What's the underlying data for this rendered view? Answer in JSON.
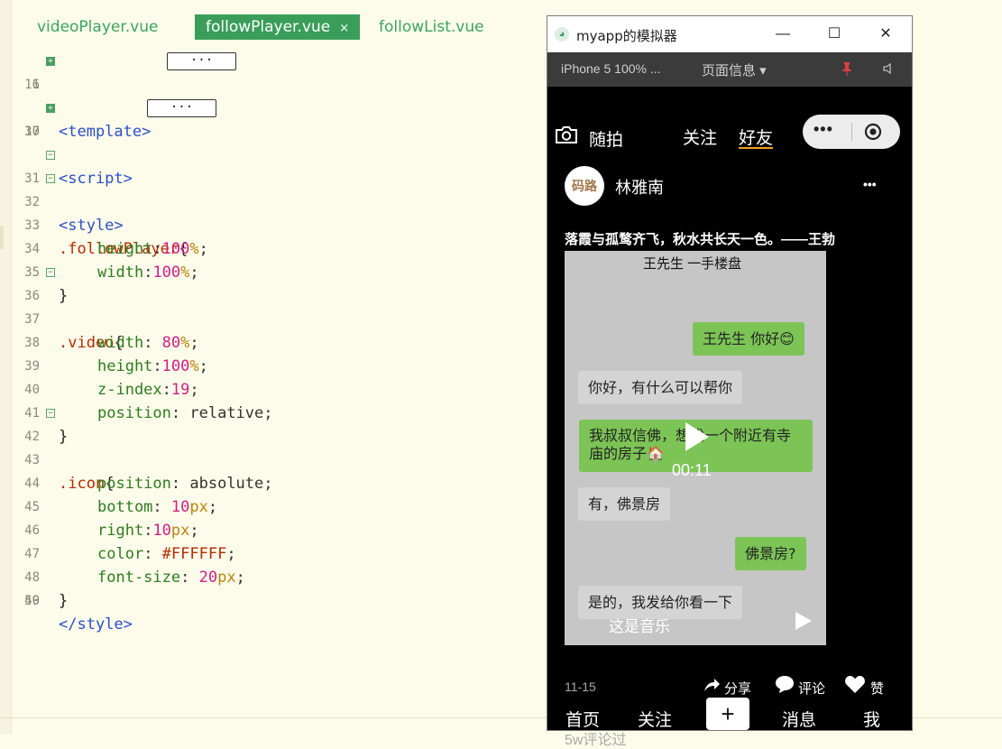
{
  "editor": {
    "tabs": [
      {
        "label": "videoPlayer.vue"
      },
      {
        "label": "followPlayer.vue",
        "close": "×"
      },
      {
        "label": "followList.vue"
      }
    ],
    "collapsed_label": "···",
    "lines": {
      "n1": "1",
      "n16": "16",
      "n17": "17",
      "n30": "30",
      "n31": "31",
      "n32": "32",
      "n33": "33",
      "n34": "34",
      "n35": "35",
      "n36": "36",
      "n37": "37",
      "n38": "38",
      "n39": "39",
      "n40": "40",
      "n41": "41",
      "n42": "42",
      "n43": "43",
      "n44": "44",
      "n45": "45",
      "n46": "46",
      "n47": "47",
      "n48": "48",
      "n49": "49",
      "n50": "50"
    },
    "code": {
      "template_tag": "<template>",
      "script_tag": "<script>",
      "style_open": "<style>",
      "sel1": ".followPlayer",
      "sel2": ".video",
      "sel3": ".icon",
      "open_brace": "{",
      "close_brace": "}",
      "height": "height",
      "width": "width",
      "z_index": "z-index",
      "position": "position",
      "bottom": "bottom",
      "right": "right",
      "color": "color",
      "font_size": "font-size",
      "colon": ":",
      "colon_sp": ": ",
      "semi": ";",
      "v100": "100",
      "pct": "%",
      "v80": "80",
      "v19": "19",
      "relative": "relative",
      "absolute": "absolute",
      "v10": "10",
      "px": "px",
      "hex": "#FFFFFF",
      "v20": "20",
      "style_close": "</style>"
    }
  },
  "simulator": {
    "window_title": "myapp的模拟器",
    "minimize": "—",
    "maximize": "☐",
    "close": "✕",
    "device_label": "iPhone 5 100% ...",
    "page_info": "页面信息 ▾",
    "top_nav": {
      "camera_label": "随拍",
      "follow": "关注",
      "friends": "好友"
    },
    "capsule": {
      "more": "•••"
    },
    "post": {
      "avatar_text": "码路",
      "username": "林雅南",
      "more": "•••",
      "caption": "落霞与孤鹜齐飞，秋水共长天一色。——王勃"
    },
    "video": {
      "chat_title": "王先生 一手楼盘",
      "messages": [
        "王先生 你好😊",
        "你好，有什么可以帮你",
        "我叔叔信佛，想找一个附近有寺",
        "庙的房子🏠",
        "有，佛景房",
        "佛景房?",
        "是的，我发给你看一下"
      ],
      "time": "00:11",
      "music": "这是音乐"
    },
    "date": "11-15",
    "actions": {
      "share": "分享",
      "comment": "评论",
      "like": "赞"
    },
    "bottom_nav": {
      "home": "首页",
      "follow": "关注",
      "add": "+",
      "messages": "消息",
      "me": "我"
    },
    "comments": "5w评论过"
  },
  "colors": {
    "editor_bg": "#fdfbea",
    "tab_active": "#3a9e5a",
    "chat_green": "#7cc456"
  }
}
